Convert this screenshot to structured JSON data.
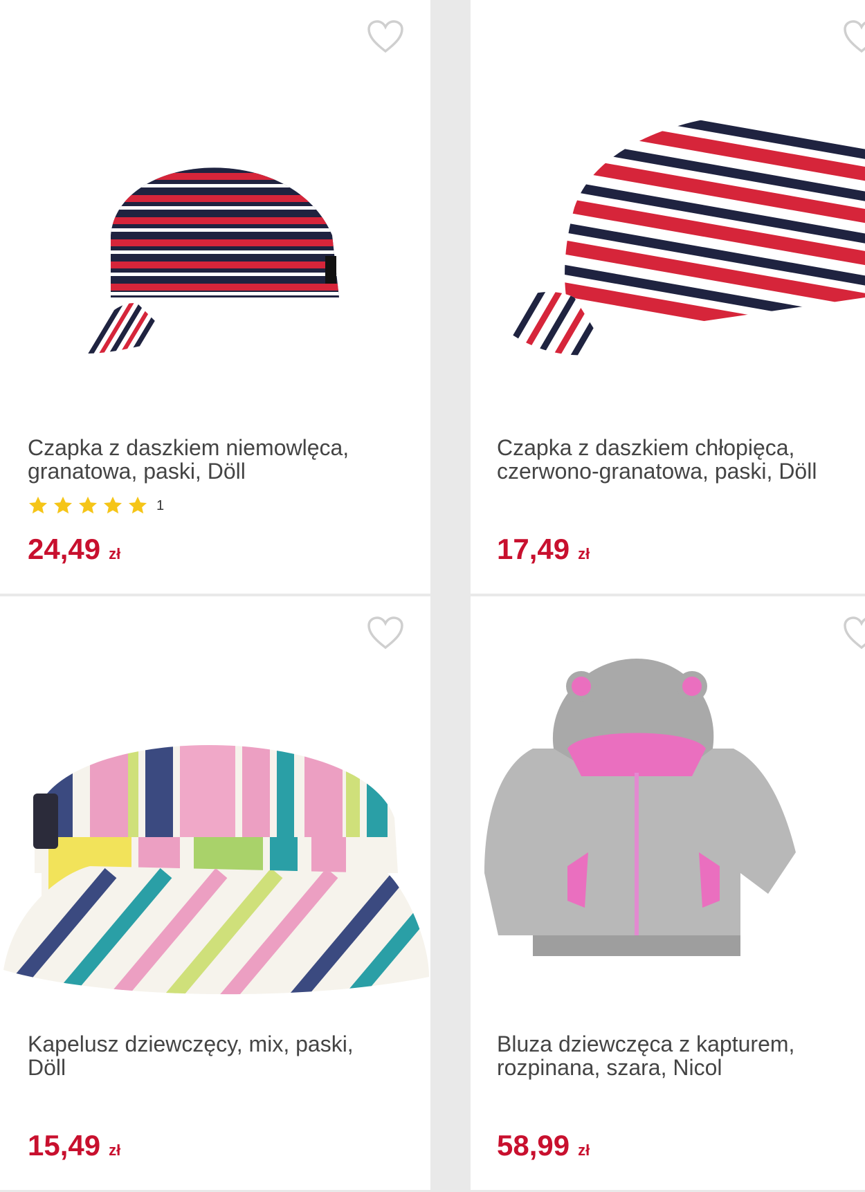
{
  "products": [
    {
      "title_line1": "Czapka z daszkiem niemowlęca,",
      "title_line2": "granatowa, paski, Döll",
      "rating_count": "1",
      "rating_stars": 5,
      "price": "24,49",
      "currency": "zł",
      "image": "striped-cap-navy-red"
    },
    {
      "title_line1": "Czapka z daszkiem chłopięca,",
      "title_line2": "czerwono-granatowa, paski, Döll",
      "price": "17,49",
      "currency": "zł",
      "image": "striped-cap-red-navy"
    },
    {
      "title_line1": "Kapelusz dziewczęcy, mix, paski,",
      "title_line2": "Döll",
      "price": "15,49",
      "currency": "zł",
      "image": "striped-bucket-hat"
    },
    {
      "title_line1": "Bluza dziewczęca z kapturem,",
      "title_line2": "rozpinana, szara, Nicol",
      "price": "58,99",
      "currency": "zł",
      "image": "grey-hoodie-pink-ears"
    }
  ],
  "icons": {
    "wishlist": "heart-outline-icon",
    "rating": "star-icon"
  },
  "colors": {
    "price": "#c8102e",
    "star": "#f5c518",
    "heart": "#cfcfcf",
    "background": "#e9e9e9"
  }
}
